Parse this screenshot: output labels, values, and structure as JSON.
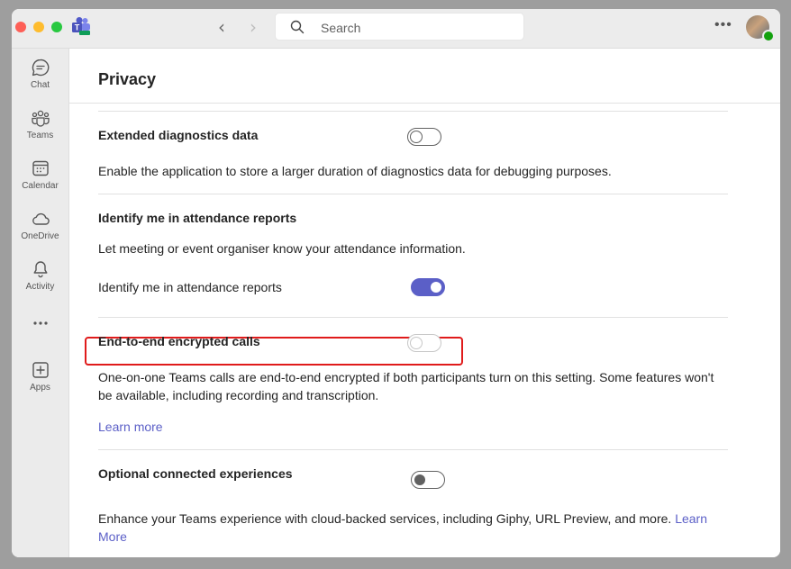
{
  "titlebar": {
    "search_placeholder": "Search"
  },
  "sidebar": {
    "items": [
      {
        "label": "Chat",
        "icon": "chat-icon"
      },
      {
        "label": "Teams",
        "icon": "teams-icon"
      },
      {
        "label": "Calendar",
        "icon": "calendar-icon"
      },
      {
        "label": "OneDrive",
        "icon": "cloud-icon"
      },
      {
        "label": "Activity",
        "icon": "bell-icon"
      },
      {
        "label": "Apps",
        "icon": "plus-square-icon"
      }
    ]
  },
  "page": {
    "title": "Privacy"
  },
  "settings": {
    "extended_diagnostics": {
      "title": "Extended diagnostics data",
      "description": "Enable the application to store a larger duration of diagnostics data for debugging purposes.",
      "enabled": false
    },
    "attendance": {
      "title": "Identify me in attendance reports",
      "description": "Let meeting or event organiser know your attendance information.",
      "toggle_label": "Identify me in attendance reports",
      "enabled": true
    },
    "e2e": {
      "title": "End-to-end encrypted calls",
      "description": "One-on-one Teams calls are end-to-end encrypted if both participants turn on this setting. Some features won't be available, including recording and transcription.",
      "learn_more": "Learn more",
      "enabled": false
    },
    "optional_experiences": {
      "title": "Optional connected experiences",
      "description": "Enhance your Teams experience with cloud-backed services, including Giphy, URL Preview, and more.",
      "learn_more": "Learn More",
      "enabled": false
    }
  },
  "colors": {
    "accent": "#5b5fc7",
    "highlight": "#e01b1b"
  }
}
